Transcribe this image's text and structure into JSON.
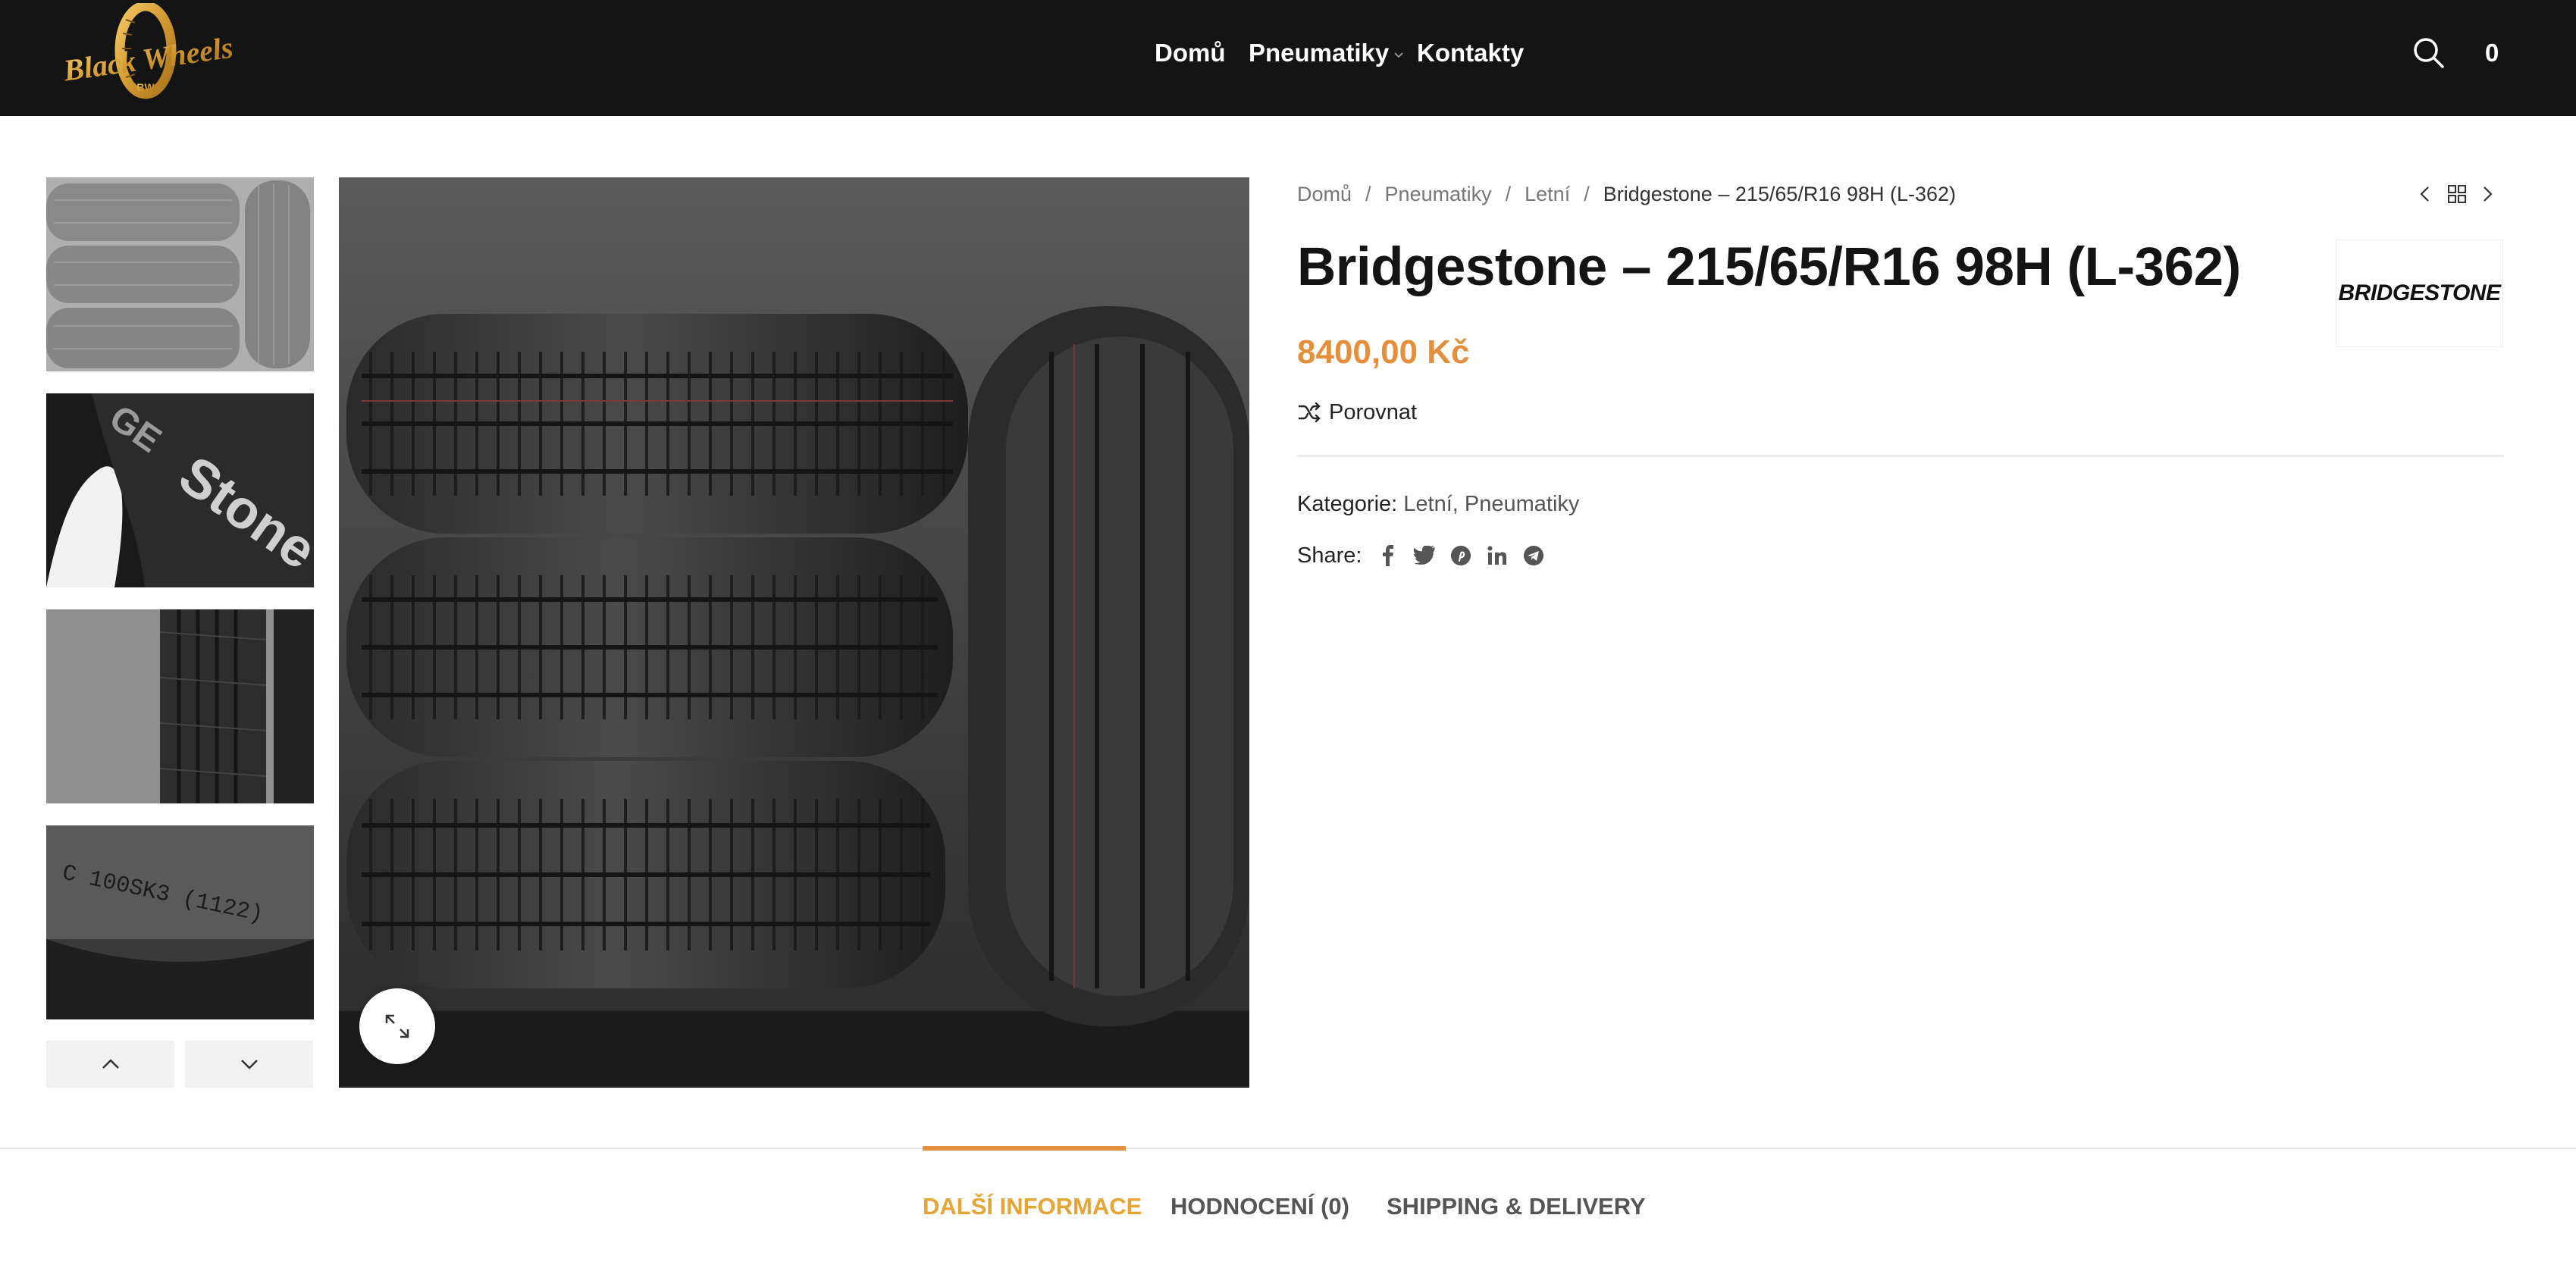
{
  "brand": {
    "logo_text": "Black Wheels",
    "logo_sub": "BW",
    "color_gold": "#d9a53b"
  },
  "nav": {
    "items": [
      {
        "label": "Domů"
      },
      {
        "label": "Pneumatiky",
        "has_dropdown": true
      },
      {
        "label": "Kontakty"
      }
    ],
    "search_icon": "search-icon",
    "cart_count": "0"
  },
  "gallery": {
    "thumbnails": [
      {
        "alt": "tyre-stack"
      },
      {
        "alt": "sidewall-bridgestone"
      },
      {
        "alt": "tread-closeup"
      },
      {
        "alt": "dot-code"
      }
    ],
    "up_icon": "chevron-up-icon",
    "down_icon": "chevron-down-icon",
    "zoom_icon": "expand-icon"
  },
  "breadcrumb": {
    "items": [
      "Domů",
      "Pneumatiky",
      "Letní"
    ],
    "current": "Bridgestone – 215/65/R16 98H (L-362)"
  },
  "product": {
    "title": "Bridgestone – 215/65/R16 98H (L-362)",
    "price": "8400,00 Kč",
    "brand_logo_text": "BRIDGESTONE",
    "compare_label": "Porovnat",
    "categories_label": "Kategorie:",
    "categories": [
      "Letní",
      "Pneumatiky"
    ],
    "category_separator": ",",
    "share_label": "Share:",
    "share_icons": [
      "facebook-icon",
      "twitter-icon",
      "pinterest-icon",
      "linkedin-icon",
      "telegram-icon"
    ],
    "price_color": "#e58f3a"
  },
  "tabs": {
    "items": [
      {
        "label": "DALŠÍ INFORMACE",
        "active": true
      },
      {
        "label": "HODNOCENÍ (0)",
        "active": false
      },
      {
        "label": "SHIPPING & DELIVERY",
        "active": false
      }
    ],
    "active_color": "#e5a434"
  }
}
